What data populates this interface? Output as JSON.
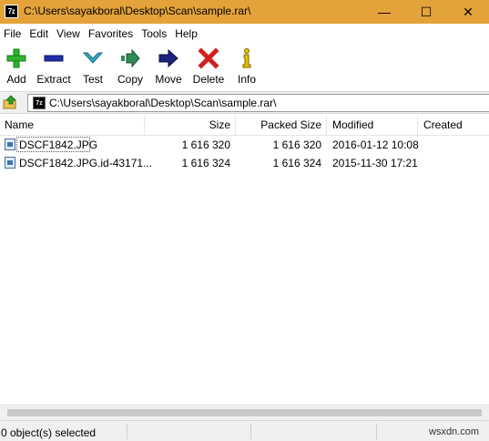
{
  "window": {
    "title": "C:\\Users\\sayakboral\\Desktop\\Scan\\sample.rar\\",
    "app_icon_text": "7z",
    "minimize_glyph": "—",
    "maximize_glyph": "☐",
    "close_glyph": "✕"
  },
  "menu": {
    "items": [
      "File",
      "Edit",
      "View",
      "Favorites",
      "Tools",
      "Help"
    ]
  },
  "toolbar": {
    "add_label": "Add",
    "extract_label": "Extract",
    "test_label": "Test",
    "copy_label": "Copy",
    "move_label": "Move",
    "delete_label": "Delete",
    "info_label": "Info",
    "colors": {
      "add": "#2db52d",
      "extract": "#1f2ea8",
      "test": "#3aa8c2",
      "copy": "#2e8b57",
      "move": "#1a237e",
      "delete": "#d21f1f",
      "info": "#e6c300"
    }
  },
  "address": {
    "path": "C:\\Users\\sayakboral\\Desktop\\Scan\\sample.rar\\",
    "icon_text": "7z"
  },
  "columns": {
    "name": "Name",
    "size": "Size",
    "packed": "Packed Size",
    "modified": "Modified",
    "created": "Created"
  },
  "files": [
    {
      "name": "DSCF1842.JPG",
      "size": "1 616 320",
      "packed": "1 616 320",
      "modified": "2016-01-12 10:08",
      "created": ""
    },
    {
      "name": "DSCF1842.JPG.id-43171...",
      "size": "1 616 324",
      "packed": "1 616 324",
      "modified": "2015-11-30 17:21",
      "created": ""
    }
  ],
  "status": {
    "selected": "0 object(s) selected",
    "watermark": "wsxdn.com"
  }
}
